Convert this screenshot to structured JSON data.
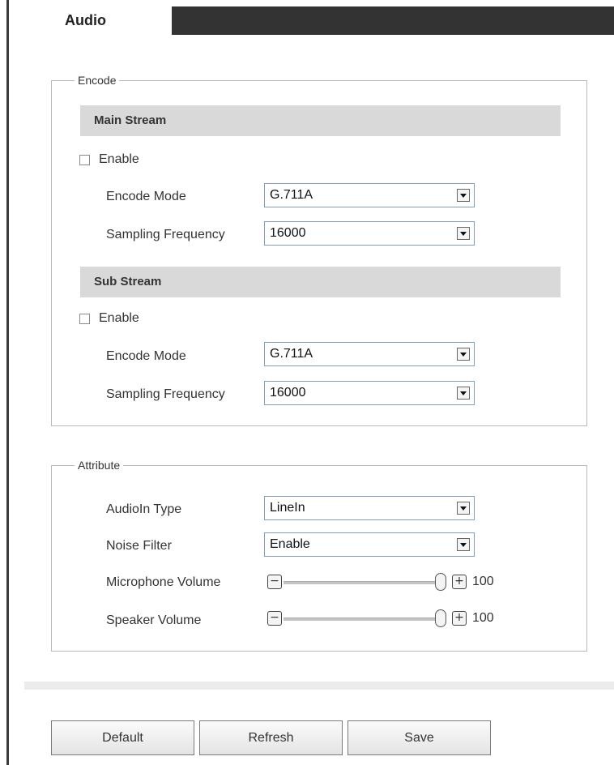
{
  "tabs": {
    "active_label": "Audio"
  },
  "encode": {
    "legend": "Encode",
    "main_stream": {
      "title": "Main Stream",
      "enable_label": "Enable",
      "enabled": false,
      "encode_mode_label": "Encode Mode",
      "encode_mode_value": "G.711A",
      "sampling_frequency_label": "Sampling Frequency",
      "sampling_frequency_value": "16000"
    },
    "sub_stream": {
      "title": "Sub Stream",
      "enable_label": "Enable",
      "enabled": false,
      "encode_mode_label": "Encode Mode",
      "encode_mode_value": "G.711A",
      "sampling_frequency_label": "Sampling Frequency",
      "sampling_frequency_value": "16000"
    }
  },
  "attribute": {
    "legend": "Attribute",
    "audioin_type_label": "AudioIn Type",
    "audioin_type_value": "LineIn",
    "noise_filter_label": "Noise Filter",
    "noise_filter_value": "Enable",
    "microphone_volume_label": "Microphone Volume",
    "microphone_volume_value": "100",
    "speaker_volume_label": "Speaker Volume",
    "speaker_volume_value": "100",
    "minus_glyph": "−",
    "plus_glyph": "+"
  },
  "buttons": {
    "default_label": "Default",
    "refresh_label": "Refresh",
    "save_label": "Save"
  },
  "icons": {
    "dropdown": "chevron-down-icon",
    "minus": "minus-icon",
    "plus": "plus-icon",
    "thumb": "slider-thumb-icon"
  },
  "colors": {
    "topbar": "#333333",
    "section_bar": "#d9d9d9",
    "border": "#b9b9b9"
  }
}
